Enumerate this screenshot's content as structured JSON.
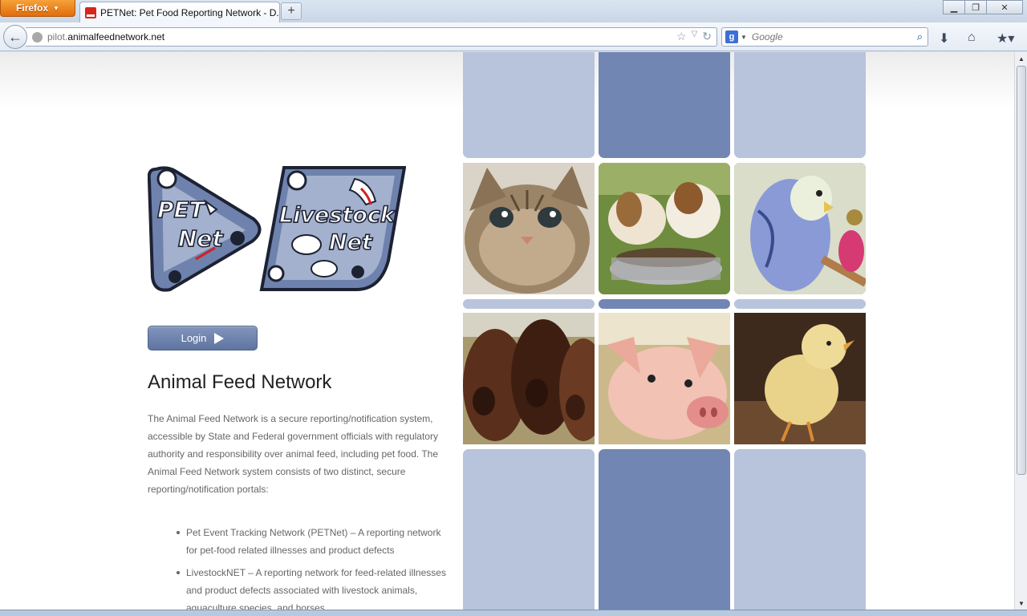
{
  "browser": {
    "menu_label": "Firefox",
    "tab_title": "PETNet: Pet Food Reporting Network - D...",
    "new_tab_label": "+",
    "url_prefix": "pilot.",
    "url_domain": "animalfeednetwork.net",
    "search_placeholder": "Google",
    "search_engine_icon": "g-icon"
  },
  "logo": {
    "pet_net_line1": "PET",
    "pet_net_line2": "Net",
    "livestock_line1": "Livestock",
    "livestock_line2": "Net"
  },
  "login": {
    "label": "Login"
  },
  "content": {
    "title": "Animal Feed Network",
    "intro": "The Animal Feed Network is a secure reporting/notification system, accessible by State and Federal government officials with regulatory authority and responsibility over animal feed, including pet food. The Animal Feed Network system consists of two distinct, secure reporting/notification portals:",
    "portals": [
      "Pet Event Tracking Network (PETNet) – A reporting network for pet-food related illnesses and product defects",
      "LivestockNET – A reporting network for feed-related illnesses and product defects associated with livestock animals, aquaculture species, and horses"
    ]
  },
  "gallery": {
    "photos": [
      "kitten",
      "puppies-eating",
      "budgie",
      "cows",
      "piglet",
      "chick"
    ]
  },
  "colors": {
    "tile_light": "#b8c4db",
    "tile_dark": "#7286b3",
    "button": "#6b7fad",
    "firefox_orange": "#e8780f"
  }
}
